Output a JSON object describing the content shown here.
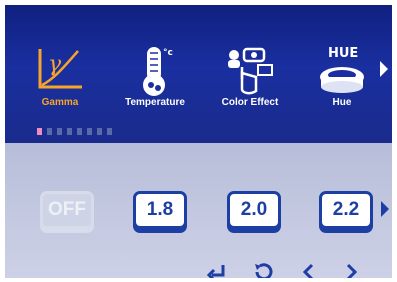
{
  "menu": {
    "items": [
      {
        "label": "Gamma",
        "icon": "gamma-icon",
        "active": true
      },
      {
        "label": "Temperature",
        "icon": "thermometer-icon"
      },
      {
        "label": "Color Effect",
        "icon": "color-effect-icon"
      },
      {
        "label": "Hue",
        "icon": "hue-icon",
        "icon_text": "HUE"
      }
    ],
    "thermometer_unit": "°c",
    "page_indicator": {
      "count": 8,
      "active_index": 0
    }
  },
  "options": [
    {
      "label": "OFF",
      "state": "disabled"
    },
    {
      "label": "1.8",
      "state": "enabled"
    },
    {
      "label": "2.0",
      "state": "enabled"
    },
    {
      "label": "2.2",
      "state": "enabled"
    }
  ],
  "controls": [
    "enter-icon",
    "back-icon",
    "left-icon",
    "right-icon"
  ],
  "colors": {
    "accent": "#f6a52a",
    "bar_blue": "#1a2fa0",
    "option_blue": "#1d3fa3",
    "active_dot": "#f08cc0"
  }
}
